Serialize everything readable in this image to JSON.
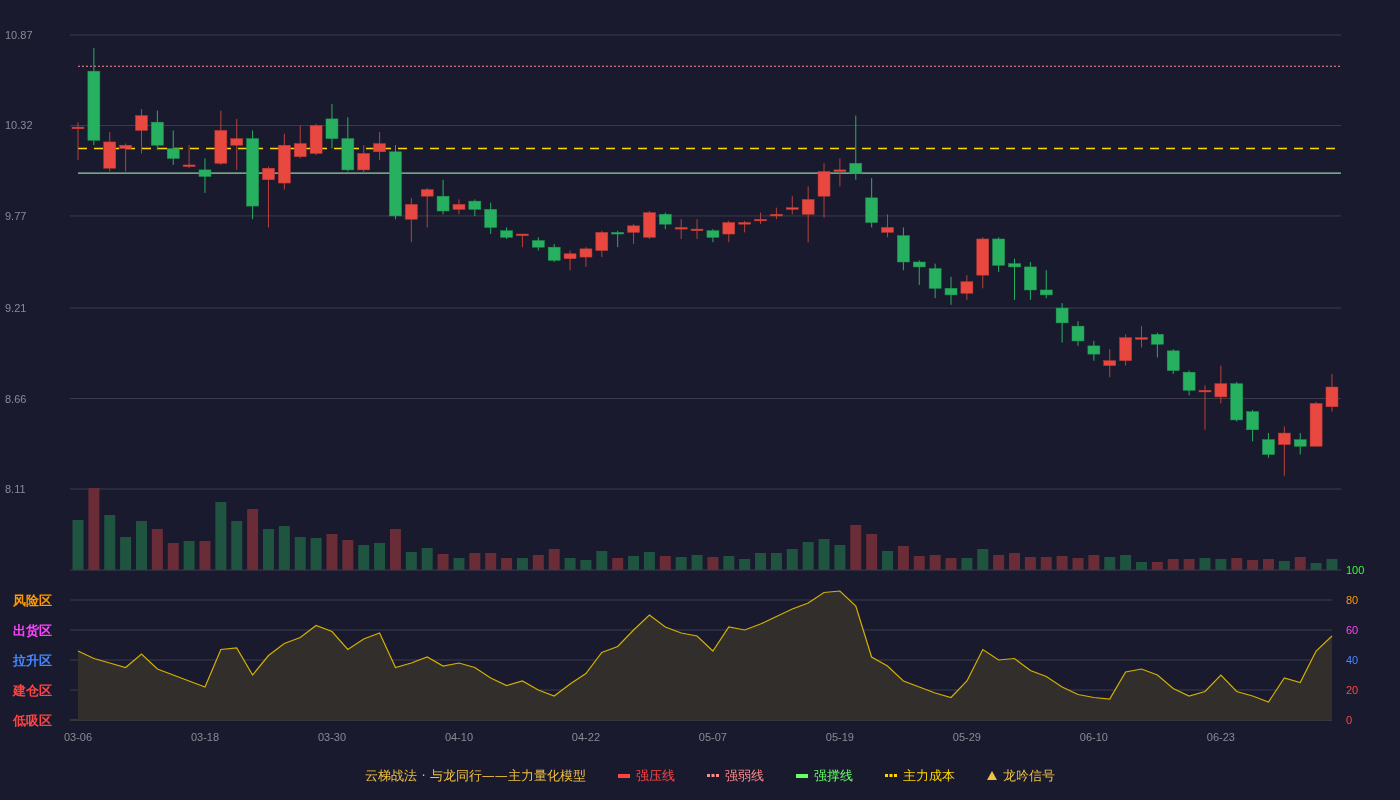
{
  "price_panel": {
    "chart_data": {
      "type": "candlestick",
      "grid": true,
      "ylim": [
        8.11,
        10.87
      ],
      "yticks": [
        10.87,
        10.32,
        9.77,
        9.21,
        8.66,
        8.11
      ],
      "categories": [
        null,
        null,
        null,
        null,
        null,
        null,
        null,
        null,
        null,
        null,
        null,
        null,
        null,
        null,
        null,
        null,
        null,
        null,
        null,
        null,
        null,
        null,
        null,
        null,
        null,
        null,
        null,
        null,
        null,
        null,
        null,
        null,
        null,
        null,
        null,
        null,
        null,
        null,
        null,
        null,
        null,
        null,
        null,
        null,
        null,
        null,
        null,
        null,
        null,
        null,
        null,
        null,
        null,
        null,
        null,
        null,
        null,
        null,
        null,
        null,
        null,
        null,
        null,
        null,
        null,
        null,
        null,
        null,
        null,
        null,
        null,
        null,
        null,
        null,
        null,
        null,
        null,
        null,
        null,
        null
      ],
      "ohlc": [
        [
          10.3,
          10.34,
          10.11,
          10.31
        ],
        [
          10.65,
          10.79,
          10.2,
          10.23
        ],
        [
          10.06,
          10.28,
          10.04,
          10.22
        ],
        [
          10.18,
          10.21,
          10.04,
          10.2
        ],
        [
          10.29,
          10.42,
          10.15,
          10.38
        ],
        [
          10.34,
          10.41,
          10.17,
          10.2
        ],
        [
          10.18,
          10.29,
          10.08,
          10.12
        ],
        [
          10.07,
          10.2,
          10.06,
          10.08
        ],
        [
          10.05,
          10.12,
          9.91,
          10.01
        ],
        [
          10.09,
          10.41,
          10.08,
          10.29
        ],
        [
          10.2,
          10.36,
          10.05,
          10.24
        ],
        [
          10.24,
          10.29,
          9.75,
          9.83
        ],
        [
          9.99,
          10.07,
          9.7,
          10.06
        ],
        [
          9.97,
          10.27,
          9.93,
          10.2
        ],
        [
          10.13,
          10.32,
          10.12,
          10.21
        ],
        [
          10.15,
          10.33,
          10.14,
          10.32
        ],
        [
          10.36,
          10.45,
          10.18,
          10.24
        ],
        [
          10.24,
          10.37,
          10.04,
          10.05
        ],
        [
          10.05,
          10.2,
          10.03,
          10.15
        ],
        [
          10.16,
          10.28,
          10.11,
          10.21
        ],
        [
          10.16,
          10.2,
          9.75,
          9.77
        ],
        [
          9.75,
          9.88,
          9.61,
          9.84
        ],
        [
          9.89,
          9.94,
          9.7,
          9.93
        ],
        [
          9.89,
          9.99,
          9.78,
          9.8
        ],
        [
          9.81,
          9.87,
          9.78,
          9.84
        ],
        [
          9.86,
          9.87,
          9.77,
          9.81
        ],
        [
          9.81,
          9.85,
          9.66,
          9.7
        ],
        [
          9.68,
          9.7,
          9.63,
          9.64
        ],
        [
          9.65,
          9.66,
          9.58,
          9.66
        ],
        [
          9.62,
          9.64,
          9.56,
          9.58
        ],
        [
          9.58,
          9.6,
          9.49,
          9.5
        ],
        [
          9.51,
          9.56,
          9.44,
          9.54
        ],
        [
          9.52,
          9.58,
          9.46,
          9.57
        ],
        [
          9.56,
          9.68,
          9.52,
          9.67
        ],
        [
          9.67,
          9.68,
          9.58,
          9.66
        ],
        [
          9.67,
          9.72,
          9.6,
          9.71
        ],
        [
          9.64,
          9.8,
          9.63,
          9.79
        ],
        [
          9.78,
          9.79,
          9.69,
          9.72
        ],
        [
          9.69,
          9.75,
          9.63,
          9.7
        ],
        [
          9.68,
          9.75,
          9.63,
          9.69
        ],
        [
          9.68,
          9.69,
          9.61,
          9.64
        ],
        [
          9.66,
          9.74,
          9.61,
          9.73
        ],
        [
          9.72,
          9.74,
          9.67,
          9.73
        ],
        [
          9.74,
          9.79,
          9.72,
          9.75
        ],
        [
          9.77,
          9.82,
          9.75,
          9.78
        ],
        [
          9.81,
          9.89,
          9.78,
          9.82
        ],
        [
          9.78,
          9.95,
          9.61,
          9.87
        ],
        [
          9.89,
          10.09,
          9.76,
          10.04
        ],
        [
          10.04,
          10.12,
          9.95,
          10.05
        ],
        [
          10.09,
          10.38,
          9.99,
          10.03
        ],
        [
          9.88,
          10.0,
          9.7,
          9.73
        ],
        [
          9.67,
          9.78,
          9.64,
          9.7
        ],
        [
          9.65,
          9.7,
          9.44,
          9.49
        ],
        [
          9.49,
          9.5,
          9.35,
          9.46
        ],
        [
          9.45,
          9.48,
          9.27,
          9.33
        ],
        [
          9.33,
          9.4,
          9.23,
          9.29
        ],
        [
          9.3,
          9.41,
          9.26,
          9.37
        ],
        [
          9.41,
          9.64,
          9.33,
          9.63
        ],
        [
          9.63,
          9.64,
          9.43,
          9.47
        ],
        [
          9.48,
          9.51,
          9.26,
          9.46
        ],
        [
          9.46,
          9.49,
          9.26,
          9.32
        ],
        [
          9.32,
          9.44,
          9.27,
          9.29
        ],
        [
          9.21,
          9.24,
          9.0,
          9.12
        ],
        [
          9.1,
          9.13,
          8.98,
          9.01
        ],
        [
          8.98,
          9.01,
          8.89,
          8.93
        ],
        [
          8.86,
          8.96,
          8.79,
          8.89
        ],
        [
          8.89,
          9.05,
          8.86,
          9.03
        ],
        [
          9.02,
          9.1,
          8.97,
          9.03
        ],
        [
          9.05,
          9.06,
          8.91,
          8.99
        ],
        [
          8.95,
          8.96,
          8.81,
          8.83
        ],
        [
          8.82,
          8.83,
          8.68,
          8.71
        ],
        [
          8.7,
          8.74,
          8.47,
          8.71
        ],
        [
          8.67,
          8.86,
          8.63,
          8.75
        ],
        [
          8.75,
          8.76,
          8.52,
          8.53
        ],
        [
          8.58,
          8.59,
          8.4,
          8.47
        ],
        [
          8.41,
          8.45,
          8.3,
          8.32
        ],
        [
          8.38,
          8.49,
          8.19,
          8.45
        ],
        [
          8.41,
          8.45,
          8.32,
          8.37
        ],
        [
          8.37,
          8.64,
          8.37,
          8.63
        ],
        [
          8.61,
          8.81,
          8.58,
          8.73
        ]
      ],
      "ref_lines": [
        {
          "axis": "y",
          "value": 10.68,
          "color": "#ff8a8a"
        },
        {
          "axis": "y",
          "value": 10.18,
          "color": "#ffd700"
        },
        {
          "axis": "y",
          "value": 10.03,
          "color": "#8fd4a0"
        }
      ]
    }
  },
  "indicator_panel": {
    "zones": [
      {
        "label": "风险区",
        "color": "#ff9900"
      },
      {
        "label": "出货区",
        "color": "#ff44ff"
      },
      {
        "label": "拉升区",
        "color": "#4488ff"
      },
      {
        "label": "建仓区",
        "color": "#ff4444"
      },
      {
        "label": "低吸区",
        "color": "#ff4444"
      }
    ],
    "chart_data": {
      "type": "area",
      "grid": true,
      "ylim": [
        0,
        100
      ],
      "yticks": [
        {
          "value": 100,
          "label": "100"
        },
        {
          "value": 80,
          "label": "80"
        },
        {
          "value": 60,
          "label": "60"
        },
        {
          "value": 40,
          "label": "40"
        },
        {
          "value": 20,
          "label": "20"
        },
        {
          "value": 0,
          "label": "0"
        }
      ],
      "categories": [
        "03-06",
        null,
        null,
        null,
        null,
        null,
        null,
        null,
        "03-18",
        null,
        null,
        null,
        null,
        null,
        null,
        null,
        "03-30",
        null,
        null,
        null,
        null,
        null,
        null,
        null,
        "04-10",
        null,
        null,
        null,
        null,
        null,
        null,
        null,
        "04-22",
        null,
        null,
        null,
        null,
        null,
        null,
        null,
        "05-07",
        null,
        null,
        null,
        null,
        null,
        null,
        null,
        "05-19",
        null,
        null,
        null,
        null,
        null,
        null,
        null,
        "05-29",
        null,
        null,
        null,
        null,
        null,
        null,
        null,
        "06-10",
        null,
        null,
        null,
        null,
        null,
        null,
        null,
        "06-23",
        null,
        null,
        null,
        null,
        null,
        null,
        null
      ],
      "values": [
        46,
        41,
        38,
        35,
        44,
        34,
        30,
        26,
        22,
        47,
        48,
        30,
        43,
        51,
        55,
        63,
        59,
        47,
        54,
        58,
        35,
        38,
        42,
        36,
        38,
        35,
        28,
        23,
        26,
        20,
        16,
        24,
        31,
        45,
        49,
        60,
        70,
        62,
        58,
        56,
        46,
        62,
        60,
        64,
        69,
        74,
        78,
        85,
        86,
        76,
        42,
        36,
        26,
        22,
        18,
        15,
        26,
        47,
        40,
        41,
        33,
        29,
        22,
        17,
        15,
        14,
        32,
        34,
        30,
        21,
        16,
        19,
        30,
        19,
        16,
        12,
        28,
        25,
        46,
        56
      ]
    }
  },
  "legend": {
    "title": "云梯战法 · 与龙同行——主力量化模型",
    "items": [
      {
        "label": "强压线",
        "kind": "solid",
        "color": "#ff4444"
      },
      {
        "label": "强弱线",
        "kind": "dashed",
        "color": "#ff8a8a"
      },
      {
        "label": "强撑线",
        "kind": "solid",
        "color": "#66ff66"
      },
      {
        "label": "主力成本",
        "kind": "dashed",
        "color": "#ffd700"
      },
      {
        "label": "龙吟信号",
        "kind": "triangle",
        "color": "#f0c040"
      }
    ]
  }
}
